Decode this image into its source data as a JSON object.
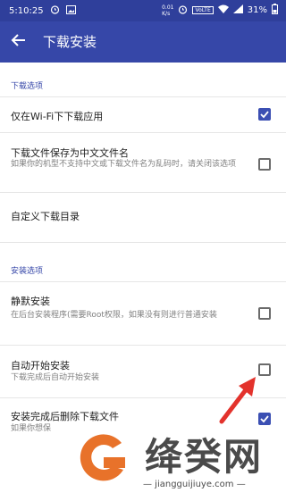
{
  "status_bar": {
    "time": "5:10:25",
    "network_speed_value": "0.01",
    "network_speed_unit": "K/s",
    "volte": "VoLTE",
    "battery": "31%"
  },
  "app_bar": {
    "back_icon": "arrow-left-icon",
    "title": "下载安装"
  },
  "sections": [
    {
      "header": "下载选项",
      "items": [
        {
          "title": "仅在Wi-Fi下下载应用",
          "subtitle": "",
          "checked": true
        },
        {
          "title": "下载文件保存为中文文件名",
          "subtitle": "如果你的机型不支持中文或下载文件名为乱码时，请关闭该选项",
          "checked": false
        },
        {
          "title": "自定义下载目录",
          "subtitle": ""
        }
      ]
    },
    {
      "header": "安装选项",
      "items": [
        {
          "title": "静默安装",
          "subtitle": "在后台安装程序(需要Root权限，如果没有则进行普通安装",
          "checked": false
        },
        {
          "title": "自动开始安装",
          "subtitle": "下载完成后自动开始安装",
          "checked": false
        },
        {
          "title": "安装完成后删除下载文件",
          "subtitle": "如果你想保",
          "checked": true
        }
      ]
    }
  ],
  "watermark": {
    "name": "绛癸网",
    "url": "— jiangguijiuye.com —"
  },
  "colors": {
    "status_bar": "#2f3f9b",
    "app_bar": "#3647a8",
    "accent": "#3b4fb3",
    "annotation_arrow": "#e3322c"
  }
}
